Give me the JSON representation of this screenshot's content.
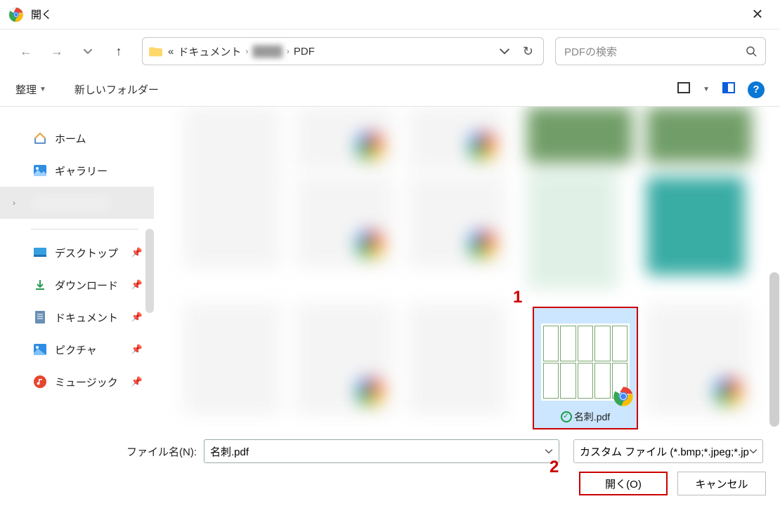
{
  "titlebar": {
    "title": "開く"
  },
  "breadcrumb": {
    "prefix": "«",
    "items": [
      "ドキュメント",
      "",
      "PDF"
    ]
  },
  "search": {
    "placeholder": "PDFの検索"
  },
  "toolbar": {
    "organize": "整理",
    "newfolder": "新しいフォルダー"
  },
  "sidebar": {
    "home": "ホーム",
    "gallery": "ギャラリー",
    "desktop": "デスクトップ",
    "downloads": "ダウンロード",
    "documents": "ドキュメント",
    "pictures": "ピクチャ",
    "music": "ミュージック"
  },
  "selected_file": {
    "name": "名刺.pdf"
  },
  "annotations": {
    "a1": "1",
    "a2": "2"
  },
  "bottom": {
    "filename_label": "ファイル名(N):",
    "filename_value": "名刺.pdf",
    "filetype": "カスタム ファイル (*.bmp;*.jpeg;*.jp",
    "open": "開く(O)",
    "cancel": "キャンセル"
  }
}
